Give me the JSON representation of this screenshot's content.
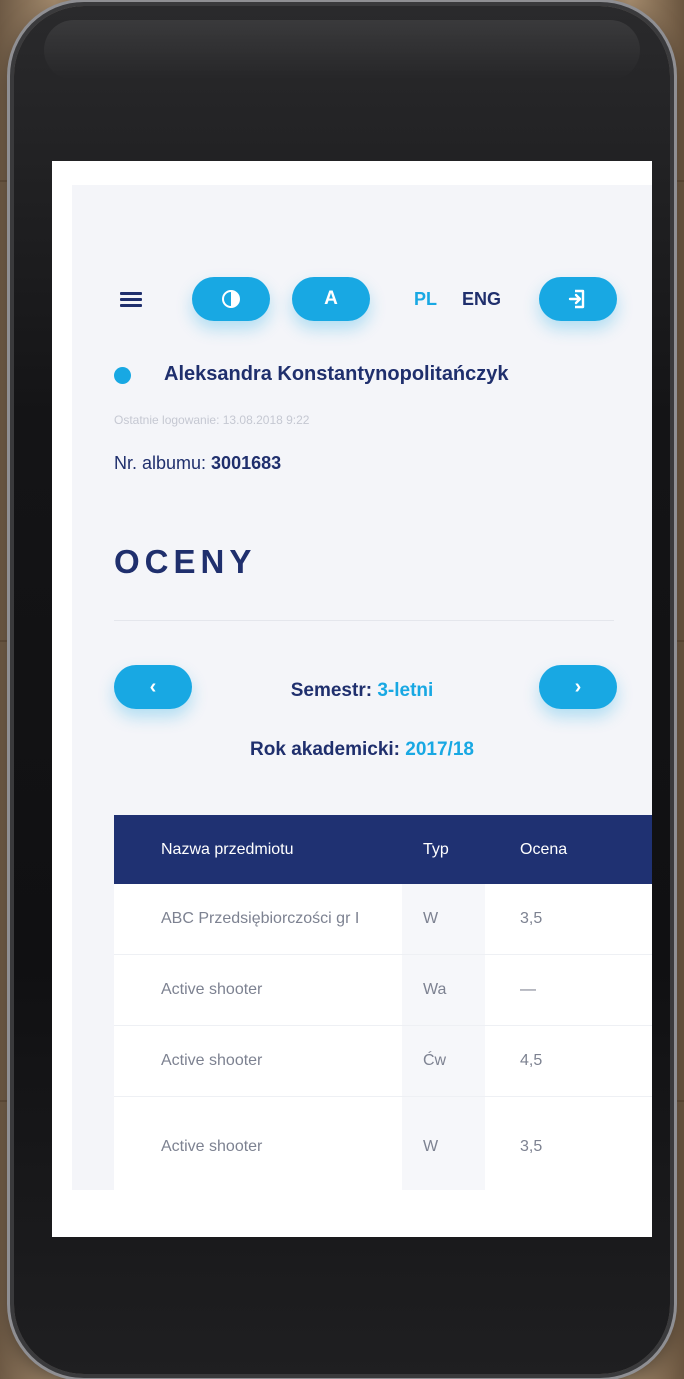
{
  "toolbar": {
    "font_button_label": "A",
    "lang_pl": "PL",
    "lang_eng": "ENG"
  },
  "user": {
    "name": "Aleksandra Konstantynopolitańczyk",
    "last_login": "Ostatnie logowanie: 13.08.2018 9:22",
    "album_label": "Nr. albumu: ",
    "album_number": "3001683"
  },
  "page": {
    "title": "OCENY"
  },
  "semester": {
    "prev_label": "‹",
    "next_label": "›",
    "semester_label": "Semestr: ",
    "semester_value": "3-letni",
    "year_label": "Rok akademicki: ",
    "year_value": "2017/18"
  },
  "table": {
    "headers": [
      "Nazwa przedmiotu",
      "Typ",
      "Ocena"
    ],
    "rows": [
      {
        "name": "ABC Przedsiębiorczości gr I",
        "type": "W",
        "grade": "3,5"
      },
      {
        "name": "Active shooter",
        "type": "Wa",
        "grade": "—"
      },
      {
        "name": "Active shooter",
        "type": "Ćw",
        "grade": "4,5"
      },
      {
        "name": "Active shooter",
        "type": "W",
        "grade": "3,5"
      }
    ]
  },
  "colors": {
    "accent": "#18a8e3",
    "navy": "#1f2f6d",
    "table_header": "#1f3172"
  },
  "icons": {
    "menu": "hamburger-menu-icon",
    "contrast": "contrast-icon",
    "logout": "logout-icon",
    "status": "status-dot-icon"
  }
}
